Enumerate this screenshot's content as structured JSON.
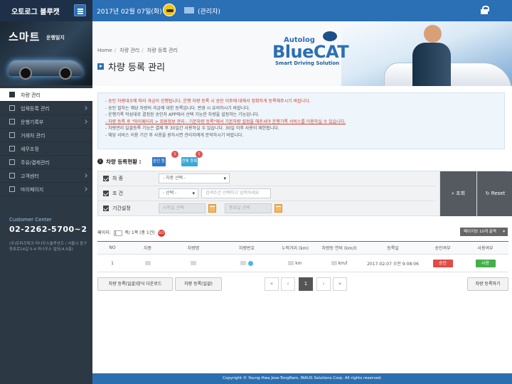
{
  "app": {
    "brand": "오토로그 블루캣",
    "date": "2017년 02월 07일(화)",
    "user_role": "(관리자)"
  },
  "sidebar": {
    "promo": {
      "title": "스마트",
      "subtitle": "운행일지"
    },
    "items": [
      {
        "label": "차량 관리",
        "active": true
      },
      {
        "label": "업체등록 관리"
      },
      {
        "label": "운행기록부"
      },
      {
        "label": "거래처 관리"
      },
      {
        "label": "세무조정"
      },
      {
        "label": "주유/결제관리"
      },
      {
        "label": "고객센터"
      },
      {
        "label": "마이페이지"
      }
    ],
    "customer_center": {
      "title": "Customer Center",
      "phone": "02-2262-5700~2",
      "address": "(주)토파즈테크 마나우스솔루션즈 / 서울시 중구 동호로14길 5-4 마나우스 빌딩(4,5층)"
    }
  },
  "banner": {
    "breadcrumb": [
      "Home",
      "차량 관리",
      "차량 등록 관리"
    ],
    "title": "차량 등록 관리",
    "logo_kicker": "Autolog",
    "logo_main": "BlueCAT",
    "logo_sub": "Smart Driving Solution"
  },
  "notice": {
    "lines": [
      "- 승인 차량대수에 따라 과금이 진행됩니다. 운행 차량 등록 시 승인 이후에 대해서 정확하게 등록해주시기 바랍니다.",
      "- 승인 절차는 해당 차량의 과금에 대한 등록입니다. 변경 시 유의하시기 바랍니다.",
      "- 운행기록 작성대로 결정된 승인차 APP에서 선택 가능한 차량을 설정하는 기능입니다.",
      "- 차량 등록 후 \"마이페이지 > 회원정보 관리 - 기본차량 등록\"에서 기본차량 설정을 해주셔야 운행기록 서비스를 이용하실 수 있습니다.",
      "- 차량관리 일괄등록 기능은 결제 후 30일간 사용하실 수 있습니다. 30일 이후 사용이 제한됩니다.",
      "- 해당 서비스 이용 기간 후 사용을 원하시면 관리자에게 문의하시기 바랍니다."
    ]
  },
  "status": {
    "label": "차량 등록현황 :",
    "approved_label": "승인 등록",
    "approved_count": "1",
    "total_label": "전체 등록",
    "total_count": "1"
  },
  "filters": {
    "vehicle_type_label": "차 종",
    "vehicle_type_value": "- 차종 선택 -",
    "condition_label": "조 건",
    "condition_value": "- 선택 -",
    "condition_placeholder": "검색조건 선택하고 입력하세요",
    "period_label": "기간설정",
    "start_placeholder": "시작일 선택",
    "separator": "~",
    "end_placeholder": "종료일 선택",
    "search_label": "조회",
    "reset_label": "Reset"
  },
  "table": {
    "page_info": "페이지:",
    "page_current": "1",
    "page_total": "쪽/ 1쪽 (총 1건)",
    "go": "GO",
    "rows_select": "페이지당 10개 출력",
    "headers": [
      "NO",
      "차종",
      "차량명",
      "차량번호",
      "누적거리 (km)",
      "차량등 연비 (km/l)",
      "등록일",
      "승인여부",
      "사용여부"
    ],
    "rows": [
      {
        "no": "1",
        "vehicle_type": "",
        "vehicle_name": "",
        "plate": "",
        "distance": "km",
        "fuel_efficiency": "km/l",
        "registered_at": "2017-02-07 오전 9:08:06",
        "approval": "승인",
        "usage": "사용"
      }
    ]
  },
  "actions": {
    "download": "차량 등록(일괄)양식 다운로드",
    "bulk_register": "차량 등록(일괄)",
    "register": "차량 등록하기"
  },
  "pagination": {
    "first": "«",
    "prev": "‹",
    "current": "1",
    "next": "›",
    "last": "»"
  },
  "footer": {
    "copyright": "Copyright © Young-Hwa Jose-TongRam, INAUS Solutions Corp. All rights reserved."
  },
  "colors": {
    "brand_blue": "#2b6fb5",
    "sidebar_dark": "#2c3843",
    "alert_red": "#d23b2b",
    "approved_red": "#e14b45",
    "usage_green": "#43b04a"
  }
}
